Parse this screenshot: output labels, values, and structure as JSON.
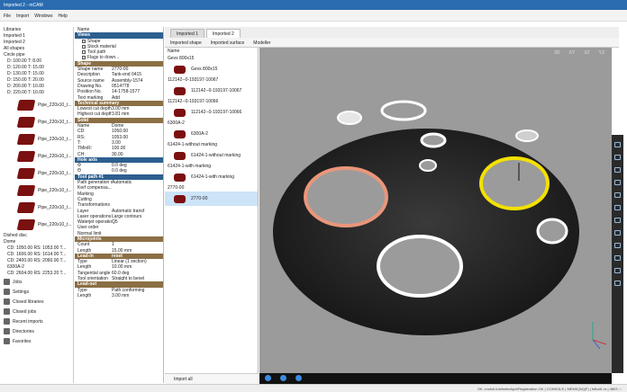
{
  "app": {
    "title": "Imported 2 - mCAM"
  },
  "menu": [
    "File",
    "Import",
    "Windows",
    "Help"
  ],
  "left": {
    "items": [
      "Libraries",
      "Imported 1",
      "Imported 2",
      "All shapes",
      "Circle pipe",
      "D: 100.00 T: 8.00",
      "D: 120.00 T: 15.00",
      "D: 130.00 T: 15.00",
      "D: 150.00 T: 20.00",
      "D: 200.00 T: 10.00",
      "D: 220.00 T: 10.00"
    ],
    "shapes": [
      "Pipe_220x10_t...",
      "Pipe_220x10_t...",
      "Pipe_220x10_t...",
      "Pipe_220x10_t...",
      "Pipe_220x10_t...",
      "Pipe_220x10_t...",
      "Pipe_220x10_t...",
      "Pipe_220x10_t..."
    ],
    "items2": [
      "Dished disc",
      "Dome",
      "CD: 1050.00 RS: 1053.00 T...",
      "CD: 1606.00 RS: 1614.00 T...",
      "CD: 2400.00 RS: 2060.00 T...",
      "6300A-2",
      "CD: 2604.00 RS: 2253.20 T..."
    ],
    "nav": [
      "Jobs",
      "Settings",
      "Closed libraries",
      "Closed jobs",
      "Recent imports",
      "Directories",
      "Favorites"
    ]
  },
  "props": {
    "name_label": "Name",
    "views": "Views",
    "view_items": [
      "Shape",
      "Stock material",
      "Tool path",
      "Flags to down..."
    ],
    "shape": "Shape",
    "shape_rows": [
      [
        "Shape name",
        "2770-00"
      ],
      [
        "Description",
        "Tank-end 0415"
      ],
      [
        "Source name",
        "Assembly-1574"
      ],
      [
        "Drawing No.",
        "0514778"
      ],
      [
        "Position No.",
        "14-1758-1577"
      ]
    ],
    "text_marking": "Text marking",
    "add": "Add",
    "tech": "Technical summary",
    "tech_rows": [
      [
        "Lowest cut depth",
        "3.00 mm"
      ],
      [
        "Highest cut depth",
        "3.81 mm"
      ]
    ],
    "solid": "Solid",
    "solid_rows": [
      [
        "Name",
        "Dome"
      ],
      [
        "CD:",
        "1050.00"
      ],
      [
        "RS:",
        "1053.00"
      ],
      [
        "T:",
        "3.00"
      ],
      [
        "TMinR:",
        "100.00"
      ],
      [
        "CH:",
        "30.00"
      ]
    ],
    "hole_axis": "Hole axis",
    "hole_rows": [
      [
        "Φ",
        "0.0 deg"
      ],
      [
        "Θ",
        "0.0 deg"
      ]
    ],
    "toolpath": "Tool path #1",
    "tp_rows": [
      [
        "Path generation m...",
        "Automatic"
      ],
      [
        "Kerf compensa...",
        ""
      ],
      [
        "Marking",
        ""
      ],
      [
        "Cutting",
        ""
      ],
      [
        "Transformations",
        ""
      ],
      [
        "Layer",
        "Automatic transf"
      ],
      [
        "Laser operations",
        "Large contours"
      ],
      [
        "Waterjet operations",
        "Q5"
      ],
      [
        "User order",
        ""
      ],
      [
        "Normal limit",
        ""
      ]
    ],
    "micro": "Microjoints",
    "micro_rows": [
      [
        "Count",
        "1"
      ],
      [
        "Length",
        "15.00 mm"
      ]
    ],
    "leadin": "Lead-in",
    "reset": "reset",
    "leadin_rows": [
      [
        "Type",
        "Linear (1 section)"
      ],
      [
        "Length",
        "10.00 mm"
      ],
      [
        "Tangential angle",
        "60.0 deg"
      ],
      [
        "Tool orientation",
        "Straight to bevel"
      ]
    ],
    "leadout": "Lead-out",
    "leadout_rows": [
      [
        "Type",
        "Path conforming"
      ],
      [
        "Length",
        "3.00 mm"
      ]
    ]
  },
  "tabs": [
    "Imported 1",
    "Imported 2"
  ],
  "subtabs": [
    "Imported shape",
    "Imported surface",
    "Modeller"
  ],
  "list": {
    "header": "Name",
    "entries": [
      {
        "t": "g",
        "label": "Gevs 800x15"
      },
      {
        "t": "i",
        "label": "Gevs 800x15"
      },
      {
        "t": "g",
        "label": "112142--0-193197-10067"
      },
      {
        "t": "i",
        "label": "112142--0-193197-10067"
      },
      {
        "t": "g",
        "label": "112142--0-193197-10066"
      },
      {
        "t": "i",
        "label": "112142--0-193197-10066"
      },
      {
        "t": "g",
        "label": "6300A-2"
      },
      {
        "t": "i",
        "label": "6300A-2"
      },
      {
        "t": "g",
        "label": "61424-1-without marking"
      },
      {
        "t": "i",
        "label": "61424-1-without marking"
      },
      {
        "t": "g",
        "label": "61424-1-with marking"
      },
      {
        "t": "i",
        "label": "61424-1-with marking"
      },
      {
        "t": "g",
        "label": "2770-00"
      },
      {
        "t": "i",
        "label": "2770-00",
        "sel": true
      }
    ]
  },
  "view": {
    "modes": [
      "3D",
      "XY",
      "XZ",
      "YZ"
    ]
  },
  "import_btn": "Import all",
  "status": "OK -mcfull-\\Unlimited\\pcl\\Registration OK | CONSOLE | MEMS(34)(F) | fsBuilt..rs | 4803 :::"
}
